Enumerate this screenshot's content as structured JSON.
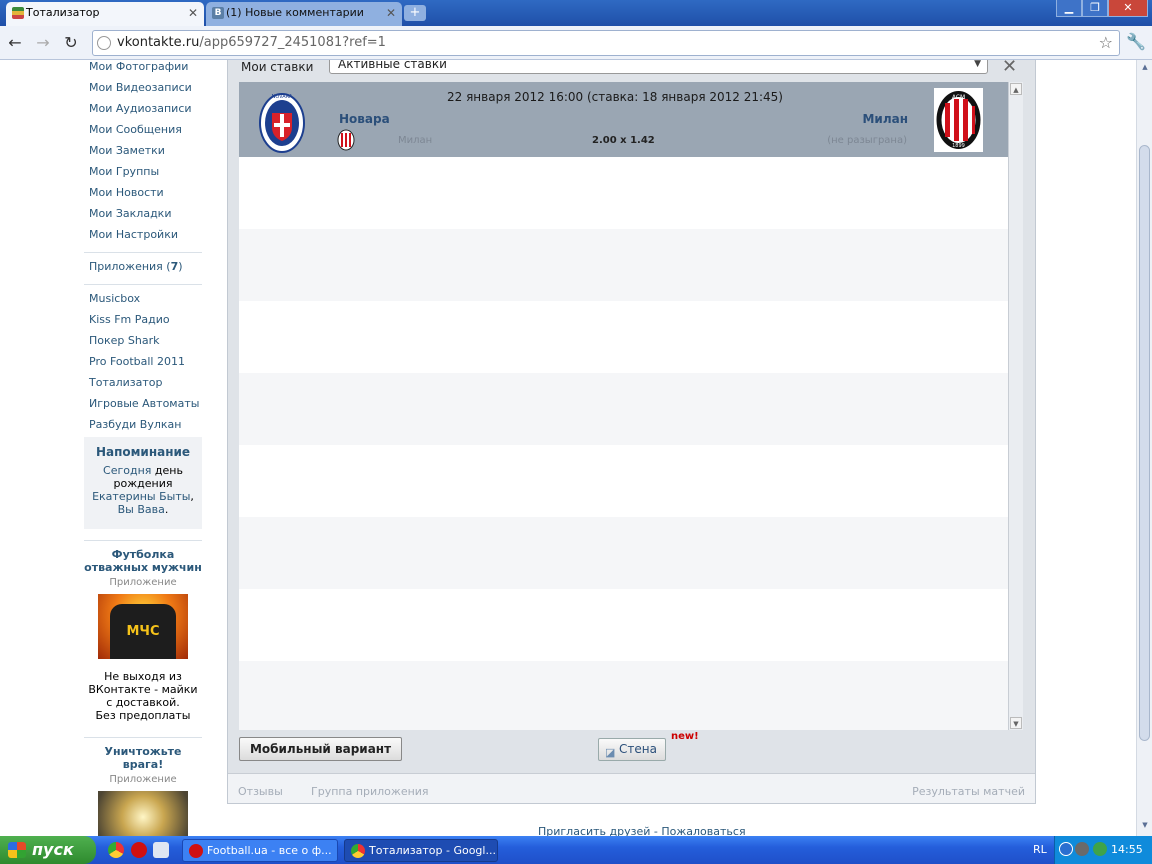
{
  "browser": {
    "tabs": [
      {
        "title": "Тотализатор",
        "active": true
      },
      {
        "title": "(1) Новые комментарии",
        "active": false
      }
    ],
    "new_tab_label": "+",
    "url_host": "vkontakte.ru",
    "url_path": "/app659727_2451081?ref=1"
  },
  "left_nav": {
    "items": [
      "Мои Фотографии",
      "Мои Видеозаписи",
      "Мои Аудиозаписи",
      "Мои Сообщения",
      "Мои Заметки",
      "Мои Группы",
      "Мои Новости",
      "Мои Закладки",
      "Мои Настройки"
    ],
    "apps_label": "Приложения (",
    "apps_count": "7",
    "apps_close": ")",
    "apps": [
      "Musicbox",
      "Kiss Fm Радио",
      "Покер Shark",
      "Pro Football 2011",
      "Тотализатор",
      "Игровые Автоматы",
      "Разбуди Вулкан"
    ]
  },
  "reminder": {
    "title": "Напоминание",
    "today": "Сегодня",
    "day_text": " день рождения ",
    "person": "Екатерины Быты",
    "sep": ", ",
    "person2": "Вы Вава",
    "end": "."
  },
  "ads": [
    {
      "title": "Футболка отважных мужчин",
      "subtitle": "Приложение",
      "image_text": "МЧС",
      "desc1": "Не выходя из ВКонтакте - майки с доставкой.",
      "desc2": "Без предоплаты"
    },
    {
      "title": "Уничтожьте врага!",
      "subtitle": "Приложение"
    }
  ],
  "app": {
    "my_bets_label": "Мои ставки",
    "bets_filter": "Активные ставки",
    "bets": [
      {
        "date": "22 января 2012 16:00 (ставка: 18 января 2012 21:45)",
        "home_team": "Новара",
        "away_team": "Милан",
        "pick": "Милан",
        "odds": "2.00 x 1.42",
        "status": "(не разыграна)"
      }
    ],
    "mobile_button": "Мобильный вариант",
    "wall_button": "Стена",
    "new_badge": "new!",
    "footer_links": [
      "Отзывы",
      "Группа приложения",
      "Результаты матчей"
    ]
  },
  "page_footer": {
    "invite": "Пригласить друзей",
    "sep": " - ",
    "complain": "Пожаловаться"
  },
  "taskbar": {
    "start_label": "пуск",
    "tasks": [
      "Football.ua - все о ф...",
      "Тотализатор - Googl..."
    ],
    "lang": "RL",
    "clock": "14:55"
  },
  "colors": {
    "vk_link": "#2b587a",
    "bet_row_bg": "#9aa6b3",
    "app_bg": "#dfe3e8",
    "xp_taskbar": "#245edb",
    "xp_start": "#2e8a2e"
  }
}
